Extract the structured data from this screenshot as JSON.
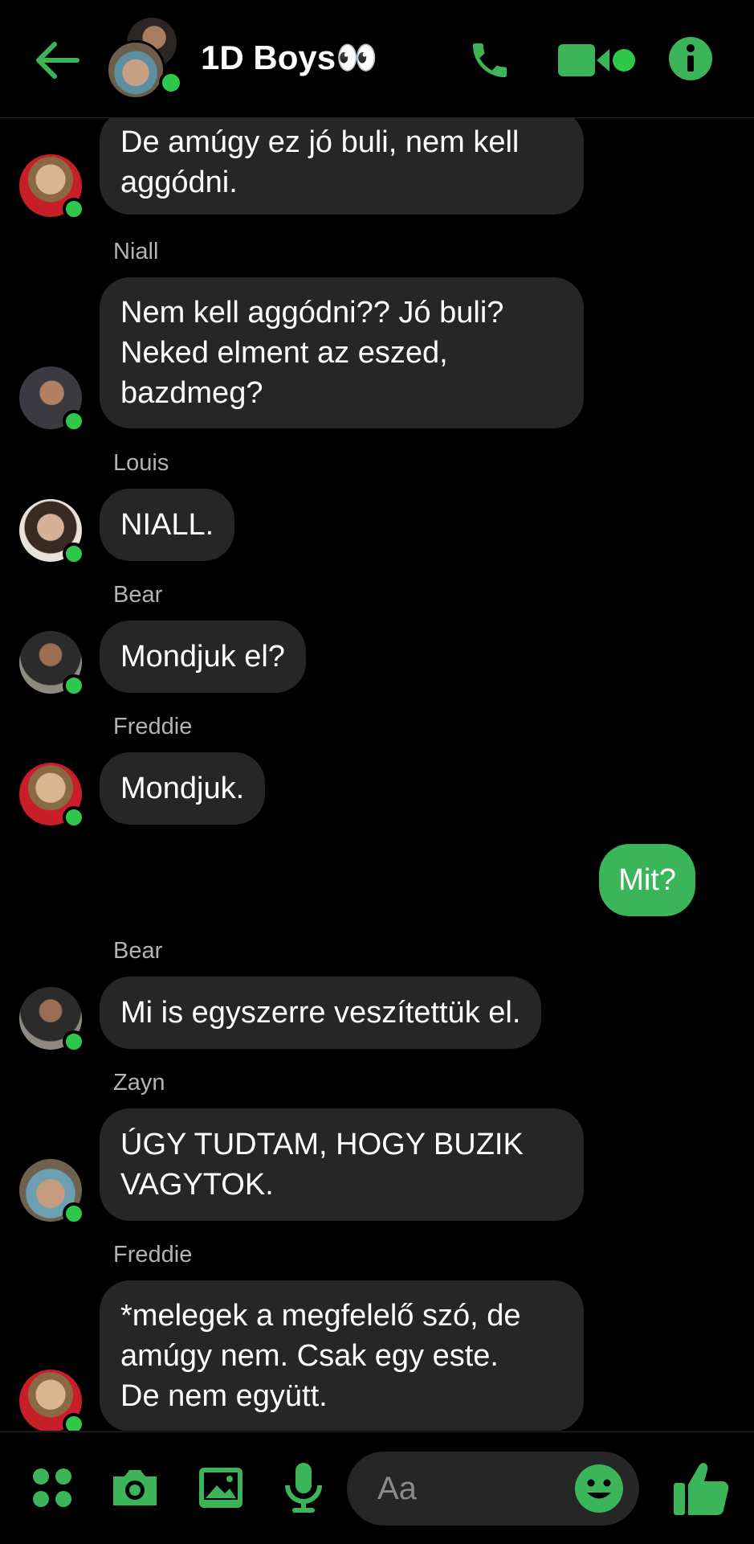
{
  "colors": {
    "accent": "#3cb55a",
    "online": "#2fc84b",
    "bubble_other": "#262626",
    "background": "#000000"
  },
  "header": {
    "title": "1D Boys👀",
    "icons": [
      "back-arrow-icon",
      "phone-icon",
      "video-camera-icon",
      "info-icon"
    ]
  },
  "messages": [
    {
      "sender": "",
      "text_lines": [
        "De amúgy ez jó buli, nem kell",
        "aggódni."
      ],
      "mine": false
    },
    {
      "sender": "Niall",
      "text_lines": [
        "Nem kell aggódni?? Jó buli?",
        "Neked elment az eszed,",
        "bazdmeg?"
      ],
      "mine": false
    },
    {
      "sender": "Louis",
      "text_lines": [
        "NIALL."
      ],
      "mine": false
    },
    {
      "sender": "Bear",
      "text_lines": [
        "Mondjuk el?"
      ],
      "mine": false
    },
    {
      "sender": "Freddie",
      "text_lines": [
        "Mondjuk."
      ],
      "mine": false
    },
    {
      "sender": "",
      "text_lines": [
        "Mit?"
      ],
      "mine": true
    },
    {
      "sender": "Bear",
      "text_lines": [
        "Mi is egyszerre veszítettük el."
      ],
      "mine": false
    },
    {
      "sender": "Zayn",
      "text_lines": [
        "ÚGY TUDTAM, HOGY BUZIK",
        "VAGYTOK."
      ],
      "mine": false
    },
    {
      "sender": "Freddie",
      "text_lines": [
        "*melegek a megfelelő szó, de",
        "amúgy nem. Csak egy este.",
        "De nem együtt."
      ],
      "mine": false
    }
  ],
  "composer": {
    "placeholder": "Aa",
    "icons": [
      "apps-grid-icon",
      "camera-icon",
      "gallery-icon",
      "microphone-icon",
      "emoji-icon",
      "thumbs-up-icon"
    ]
  }
}
